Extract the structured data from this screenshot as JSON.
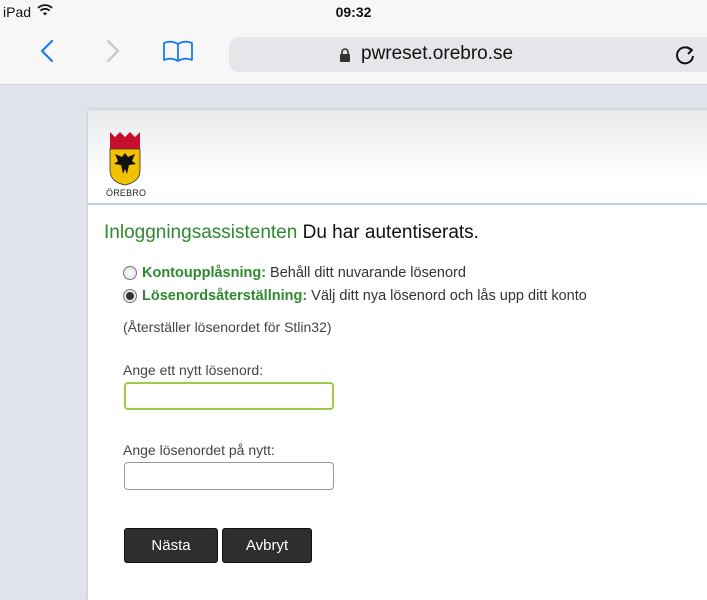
{
  "status_bar": {
    "device": "iPad",
    "time": "09:32"
  },
  "browser": {
    "url": "pwreset.orebro.se"
  },
  "header": {
    "logo_text": "ÖREBRO"
  },
  "main": {
    "heading_title": "Inloggningsassistenten",
    "heading_status": "Du har autentiserats.",
    "options": [
      {
        "label": "Kontoupplåsning:",
        "description": "Behåll ditt nuvarande lösenord",
        "selected": false
      },
      {
        "label": "Lösenordsåterställning:",
        "description": "Välj ditt nya lösenord och lås upp ditt konto",
        "selected": true
      }
    ],
    "reset_note": "(Återställer lösenordet för Stlin32)",
    "new_password_label": "Ange ett nytt lösenord:",
    "new_password_value": "",
    "repeat_password_label": "Ange lösenordet på nytt:",
    "repeat_password_value": "",
    "next_button": "Nästa",
    "cancel_button": "Avbryt"
  },
  "colors": {
    "accent_green": "#2e8a2e",
    "focus_green": "#9ccb48",
    "ios_blue": "#1a7cf5",
    "button_dark": "#2e2e2e"
  }
}
